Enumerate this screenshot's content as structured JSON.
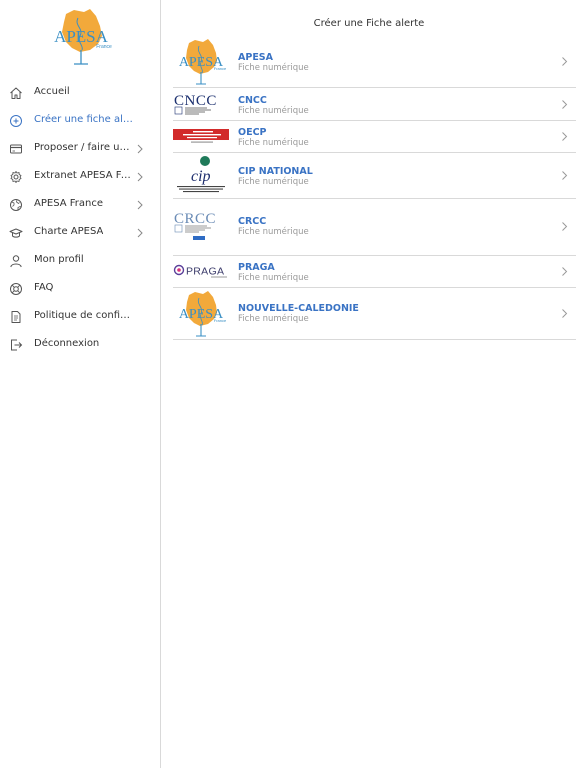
{
  "sidebar": {
    "brand": {
      "name": "APESA",
      "sub": "France"
    },
    "items": [
      {
        "id": "accueil",
        "label": "Accueil",
        "icon": "home-icon",
        "chevron": false,
        "active": false
      },
      {
        "id": "creer",
        "label": "Créer une fiche alerte",
        "icon": "plus-circle-icon",
        "chevron": false,
        "active": true
      },
      {
        "id": "proposer",
        "label": "Proposer / faire un d...",
        "icon": "card-icon",
        "chevron": true,
        "active": false
      },
      {
        "id": "extranet",
        "label": "Extranet APESA Fra...",
        "icon": "gear-icon",
        "chevron": true,
        "active": false
      },
      {
        "id": "apesa-france",
        "label": "APESA France",
        "icon": "globe-icon",
        "chevron": true,
        "active": false
      },
      {
        "id": "charte",
        "label": "Charte APESA",
        "icon": "graduation-cap-icon",
        "chevron": true,
        "active": false
      },
      {
        "id": "profil",
        "label": "Mon profil",
        "icon": "user-icon",
        "chevron": false,
        "active": false
      },
      {
        "id": "faq",
        "label": "FAQ",
        "icon": "lifebuoy-icon",
        "chevron": false,
        "active": false
      },
      {
        "id": "politique",
        "label": "Politique de confidenti...",
        "icon": "document-icon",
        "chevron": false,
        "active": false
      },
      {
        "id": "deconnexion",
        "label": "Déconnexion",
        "icon": "logout-icon",
        "chevron": false,
        "active": false
      }
    ]
  },
  "main": {
    "title": "Créer une Fiche alerte",
    "orgs": [
      {
        "id": "apesa",
        "name": "APESA",
        "subtitle": "Fiche numérique",
        "logo": "apesa-logo"
      },
      {
        "id": "cncc",
        "name": "CNCC",
        "subtitle": "Fiche numérique",
        "logo": "cncc-logo"
      },
      {
        "id": "oecp",
        "name": "OECP",
        "subtitle": "Fiche numérique",
        "logo": "oecp-logo"
      },
      {
        "id": "cip",
        "name": "CIP NATIONAL",
        "subtitle": "Fiche numérique",
        "logo": "cip-logo"
      },
      {
        "id": "crcc",
        "name": "CRCC",
        "subtitle": "Fiche numérique",
        "logo": "crcc-logo"
      },
      {
        "id": "praga",
        "name": "PRAGA",
        "subtitle": "Fiche numérique",
        "logo": "praga-logo"
      },
      {
        "id": "nc",
        "name": "NOUVELLE-CALEDONIE",
        "subtitle": "Fiche numérique",
        "logo": "apesa-logo"
      }
    ]
  },
  "colors": {
    "accent": "#3a73c4",
    "text": "#333333",
    "muted": "#9a9a9a",
    "divider": "#d9d9d9",
    "apesa_orange": "#f2a93b",
    "oecp_red": "#d22a2a",
    "cip_green": "#1f7a5a"
  }
}
